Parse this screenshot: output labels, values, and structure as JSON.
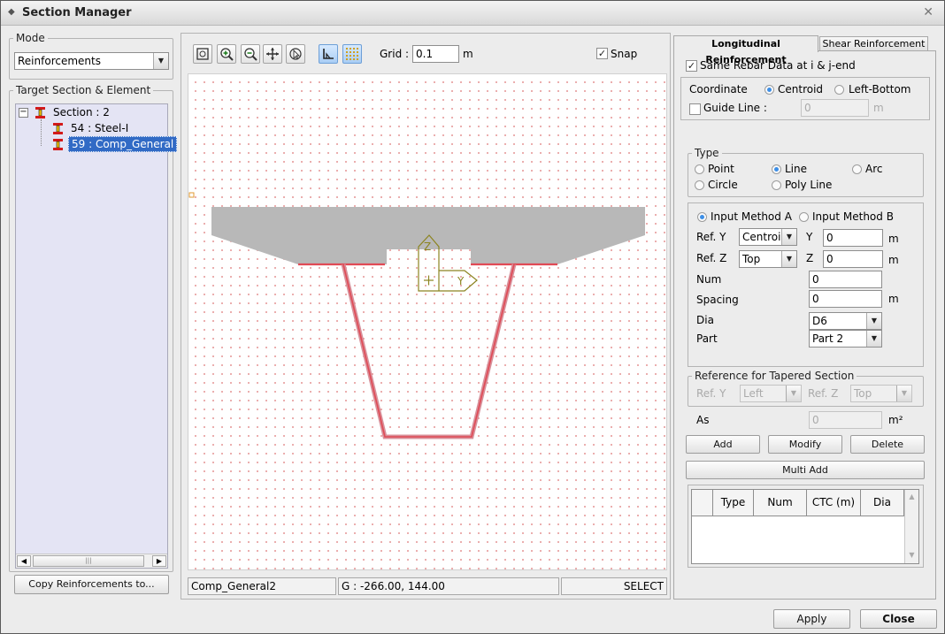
{
  "window": {
    "title": "Section Manager"
  },
  "mode": {
    "label": "Mode",
    "value": "Reinforcements"
  },
  "target": {
    "label": "Target Section & Element",
    "root": "Section : 2",
    "children": [
      "54 : Steel-I",
      "59 : Comp_General"
    ]
  },
  "left_footer": {
    "copy_button": "Copy Reinforcements to..."
  },
  "toolbar": {
    "grid_label": "Grid :",
    "grid_value": "0.1",
    "grid_unit": "m",
    "snap_label": "Snap"
  },
  "canvas": {
    "axis_z": "Z",
    "axis_y": "Y"
  },
  "statusbar": {
    "section": "Comp_General2",
    "coords": "G : -266.00, 144.00",
    "mode": "SELECT"
  },
  "tabs": {
    "longitudinal": "Longitudinal Reinforcement",
    "shear": "Shear Reinforcement"
  },
  "rebar": {
    "same_rebar": "Same Rebar Data at i & j-end",
    "coordinate_label": "Coordinate",
    "coord_centroid": "Centroid",
    "coord_left_bottom": "Left-Bottom",
    "guide_line": "Guide Line :",
    "guide_value": "0",
    "guide_unit": "m",
    "type_label": "Type",
    "type_point": "Point",
    "type_line": "Line",
    "type_arc": "Arc",
    "type_circle": "Circle",
    "type_polyline": "Poly Line",
    "method_a": "Input Method A",
    "method_b": "Input Method B",
    "ref_y_label": "Ref. Y",
    "ref_y_value": "Centroid",
    "y_label": "Y",
    "y_value": "0",
    "ref_z_label": "Ref. Z",
    "ref_z_value": "Top",
    "z_label": "Z",
    "z_value": "0",
    "unit_m": "m",
    "num_label": "Num",
    "num_value": "0",
    "spacing_label": "Spacing",
    "spacing_value": "0",
    "dia_label": "Dia",
    "dia_value": "D6",
    "part_label": "Part",
    "part_value": "Part 2",
    "taper_label": "Reference for Tapered Section",
    "taper_ref_y": "Ref. Y",
    "taper_ref_y_value": "Left",
    "taper_ref_z": "Ref. Z",
    "taper_ref_z_value": "Top",
    "as_label": "As",
    "as_value": "0",
    "as_unit": "m²",
    "add": "Add",
    "modify": "Modify",
    "delete": "Delete",
    "multi_add": "Multi Add",
    "table_headers": [
      "Type",
      "Num",
      "CTC (m)",
      "Dia"
    ]
  },
  "buttons": {
    "apply": "Apply",
    "close": "Close"
  },
  "colors": {
    "accent": "#316ac5",
    "rebar": "#e04a55",
    "section_fill": "#b8b8b8",
    "axis": "#8c8420"
  }
}
